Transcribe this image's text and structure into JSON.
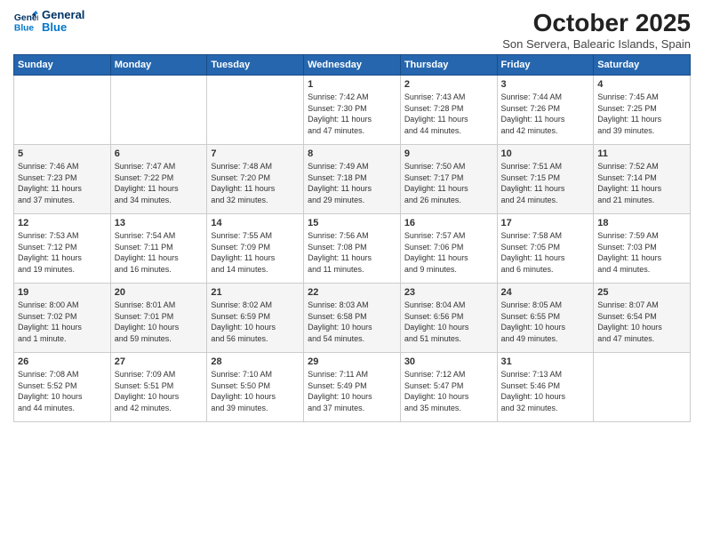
{
  "logo": {
    "line1": "General",
    "line2": "Blue"
  },
  "title": "October 2025",
  "subtitle": "Son Servera, Balearic Islands, Spain",
  "days_of_week": [
    "Sunday",
    "Monday",
    "Tuesday",
    "Wednesday",
    "Thursday",
    "Friday",
    "Saturday"
  ],
  "weeks": [
    [
      {
        "day": "",
        "info": ""
      },
      {
        "day": "",
        "info": ""
      },
      {
        "day": "",
        "info": ""
      },
      {
        "day": "1",
        "info": "Sunrise: 7:42 AM\nSunset: 7:30 PM\nDaylight: 11 hours\nand 47 minutes."
      },
      {
        "day": "2",
        "info": "Sunrise: 7:43 AM\nSunset: 7:28 PM\nDaylight: 11 hours\nand 44 minutes."
      },
      {
        "day": "3",
        "info": "Sunrise: 7:44 AM\nSunset: 7:26 PM\nDaylight: 11 hours\nand 42 minutes."
      },
      {
        "day": "4",
        "info": "Sunrise: 7:45 AM\nSunset: 7:25 PM\nDaylight: 11 hours\nand 39 minutes."
      }
    ],
    [
      {
        "day": "5",
        "info": "Sunrise: 7:46 AM\nSunset: 7:23 PM\nDaylight: 11 hours\nand 37 minutes."
      },
      {
        "day": "6",
        "info": "Sunrise: 7:47 AM\nSunset: 7:22 PM\nDaylight: 11 hours\nand 34 minutes."
      },
      {
        "day": "7",
        "info": "Sunrise: 7:48 AM\nSunset: 7:20 PM\nDaylight: 11 hours\nand 32 minutes."
      },
      {
        "day": "8",
        "info": "Sunrise: 7:49 AM\nSunset: 7:18 PM\nDaylight: 11 hours\nand 29 minutes."
      },
      {
        "day": "9",
        "info": "Sunrise: 7:50 AM\nSunset: 7:17 PM\nDaylight: 11 hours\nand 26 minutes."
      },
      {
        "day": "10",
        "info": "Sunrise: 7:51 AM\nSunset: 7:15 PM\nDaylight: 11 hours\nand 24 minutes."
      },
      {
        "day": "11",
        "info": "Sunrise: 7:52 AM\nSunset: 7:14 PM\nDaylight: 11 hours\nand 21 minutes."
      }
    ],
    [
      {
        "day": "12",
        "info": "Sunrise: 7:53 AM\nSunset: 7:12 PM\nDaylight: 11 hours\nand 19 minutes."
      },
      {
        "day": "13",
        "info": "Sunrise: 7:54 AM\nSunset: 7:11 PM\nDaylight: 11 hours\nand 16 minutes."
      },
      {
        "day": "14",
        "info": "Sunrise: 7:55 AM\nSunset: 7:09 PM\nDaylight: 11 hours\nand 14 minutes."
      },
      {
        "day": "15",
        "info": "Sunrise: 7:56 AM\nSunset: 7:08 PM\nDaylight: 11 hours\nand 11 minutes."
      },
      {
        "day": "16",
        "info": "Sunrise: 7:57 AM\nSunset: 7:06 PM\nDaylight: 11 hours\nand 9 minutes."
      },
      {
        "day": "17",
        "info": "Sunrise: 7:58 AM\nSunset: 7:05 PM\nDaylight: 11 hours\nand 6 minutes."
      },
      {
        "day": "18",
        "info": "Sunrise: 7:59 AM\nSunset: 7:03 PM\nDaylight: 11 hours\nand 4 minutes."
      }
    ],
    [
      {
        "day": "19",
        "info": "Sunrise: 8:00 AM\nSunset: 7:02 PM\nDaylight: 11 hours\nand 1 minute."
      },
      {
        "day": "20",
        "info": "Sunrise: 8:01 AM\nSunset: 7:01 PM\nDaylight: 10 hours\nand 59 minutes."
      },
      {
        "day": "21",
        "info": "Sunrise: 8:02 AM\nSunset: 6:59 PM\nDaylight: 10 hours\nand 56 minutes."
      },
      {
        "day": "22",
        "info": "Sunrise: 8:03 AM\nSunset: 6:58 PM\nDaylight: 10 hours\nand 54 minutes."
      },
      {
        "day": "23",
        "info": "Sunrise: 8:04 AM\nSunset: 6:56 PM\nDaylight: 10 hours\nand 51 minutes."
      },
      {
        "day": "24",
        "info": "Sunrise: 8:05 AM\nSunset: 6:55 PM\nDaylight: 10 hours\nand 49 minutes."
      },
      {
        "day": "25",
        "info": "Sunrise: 8:07 AM\nSunset: 6:54 PM\nDaylight: 10 hours\nand 47 minutes."
      }
    ],
    [
      {
        "day": "26",
        "info": "Sunrise: 7:08 AM\nSunset: 5:52 PM\nDaylight: 10 hours\nand 44 minutes."
      },
      {
        "day": "27",
        "info": "Sunrise: 7:09 AM\nSunset: 5:51 PM\nDaylight: 10 hours\nand 42 minutes."
      },
      {
        "day": "28",
        "info": "Sunrise: 7:10 AM\nSunset: 5:50 PM\nDaylight: 10 hours\nand 39 minutes."
      },
      {
        "day": "29",
        "info": "Sunrise: 7:11 AM\nSunset: 5:49 PM\nDaylight: 10 hours\nand 37 minutes."
      },
      {
        "day": "30",
        "info": "Sunrise: 7:12 AM\nSunset: 5:47 PM\nDaylight: 10 hours\nand 35 minutes."
      },
      {
        "day": "31",
        "info": "Sunrise: 7:13 AM\nSunset: 5:46 PM\nDaylight: 10 hours\nand 32 minutes."
      },
      {
        "day": "",
        "info": ""
      }
    ]
  ]
}
